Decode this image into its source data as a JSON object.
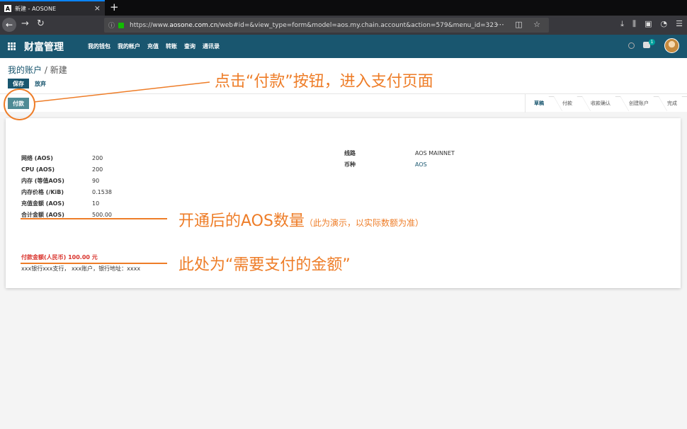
{
  "browser": {
    "tab_title": "新建 - AOSONE",
    "tab_favicon": "A",
    "tab_close": "×",
    "new_tab": "+",
    "url_prefix": "https://www.",
    "url_domain": "aosone.com.cn",
    "url_rest": "/web#id=&view_type=form&model=aos.my.chain.account&action=579&menu_id=323"
  },
  "app": {
    "brand": "财富管理",
    "menu": [
      "我的钱包",
      "我的帐户",
      "充值",
      "转账",
      "查询",
      "通讯录"
    ],
    "chat_badge": "1"
  },
  "breadcrumb": {
    "parent": "我的账户",
    "sep": "/",
    "current": "新建"
  },
  "buttons": {
    "save": "保存",
    "discard": "放弃",
    "pay": "付款"
  },
  "stages": [
    "草稿",
    "付款",
    "收款确认",
    "创建账户",
    "完成"
  ],
  "stage_active": "草稿",
  "form": {
    "left": [
      {
        "label": "网络 (AOS)",
        "value": "200"
      },
      {
        "label": "CPU (AOS)",
        "value": "200"
      },
      {
        "label": "内存 (等值AOS)",
        "value": "90"
      },
      {
        "label": "内存价格 (/KiB)",
        "value": "0.1538"
      },
      {
        "label": "充值金额 (AOS)",
        "value": "10"
      },
      {
        "label": "合计金额 (AOS)",
        "value": "500.00"
      }
    ],
    "right": [
      {
        "label": "线路",
        "value": "AOS MAINNET"
      },
      {
        "label": "币种",
        "value": "AOS"
      }
    ],
    "pay_amount": "付款金额(人民币) 100.00 元",
    "bank_info": "xxx银行xxx支行， xxx账户，银行地址：xxxx"
  },
  "annotations": {
    "pay_button": "点击“付款”按钮，进入支付页面",
    "aos_amount": "开通后的AOS数量",
    "aos_note": "（此为演示，以实际数额为准）",
    "pay_total": "此处为“需要支付的金额”"
  },
  "colors": {
    "primary": "#19566f",
    "annotation": "#ee7d28",
    "pay_red": "#d9312a"
  }
}
